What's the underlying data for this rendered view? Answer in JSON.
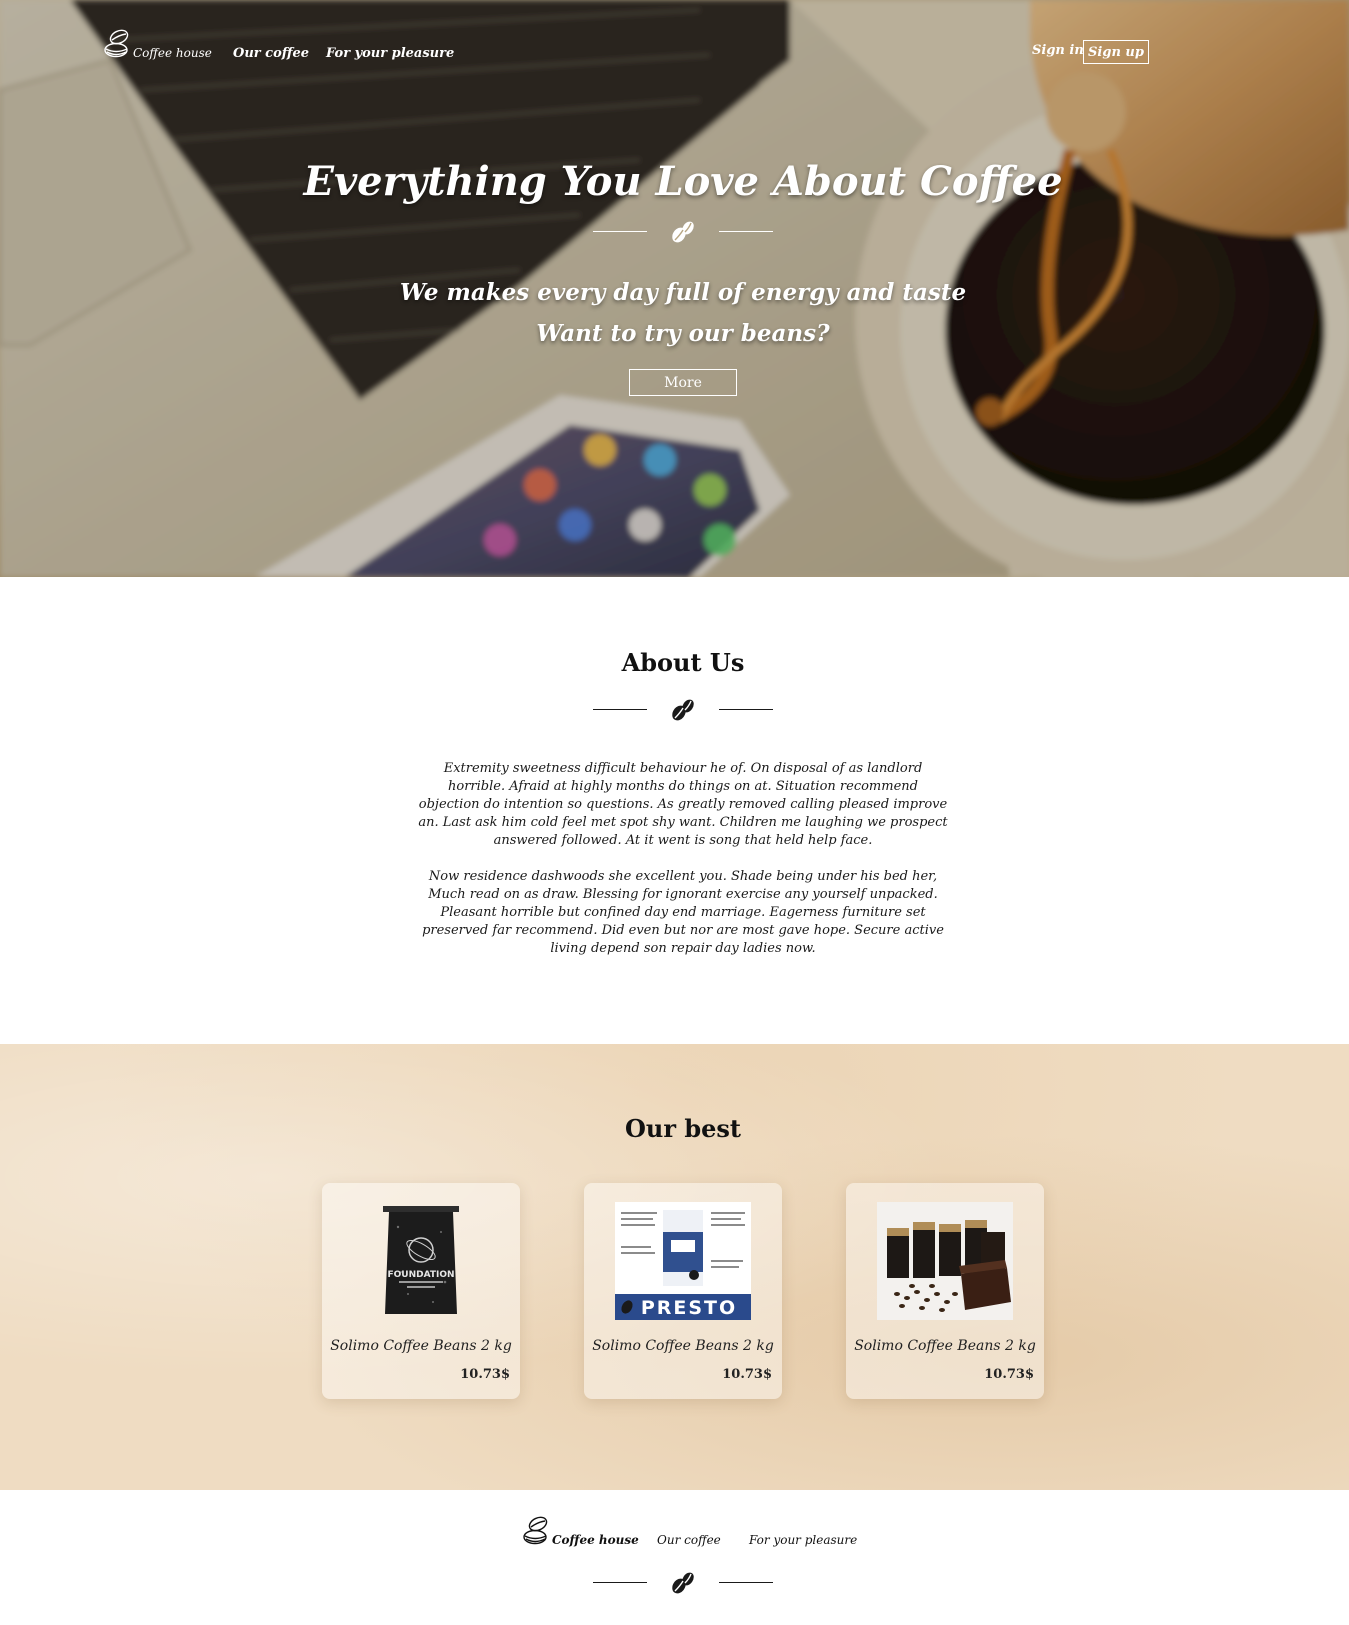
{
  "header": {
    "logo_text": "Coffee house",
    "nav": [
      "Our coffee",
      "For your pleasure"
    ],
    "sign_in": "Sign in",
    "sign_up": "Sign up"
  },
  "hero": {
    "title": "Everything You Love About Coffee",
    "subtitle_1": "We makes every day full of energy and taste",
    "subtitle_2": "Want to try our beans?",
    "button": "More",
    "icon": "coffee-beans-icon"
  },
  "about": {
    "title": "About Us",
    "paragraphs": [
      "Extremity sweetness difficult behaviour he of. On disposal of as landlord horrible. Afraid at highly months do things on at. Situation recommend objection do intention so questions. As greatly removed calling pleased improve an. Last ask him cold feel met spot shy want. Children me laughing we prospect answered followed. At it went is song that held help face.",
      "Now residence dashwoods she excellent you. Shade being under his bed her, Much read on as draw. Blessing for ignorant exercise any yourself unpacked. Pleasant horrible but confined day end marriage. Eagerness furniture set preserved far recommend. Did even but nor are most gave hope. Secure active living depend son repair day ladies now."
    ]
  },
  "best": {
    "title": "Our best",
    "products": [
      {
        "name": "Solimo Coffee Beans 2 kg",
        "price": "10.73$",
        "image_label": "FOUNDATION"
      },
      {
        "name": "Solimo Coffee Beans 2 kg",
        "price": "10.73$",
        "image_label": "PRESTO"
      },
      {
        "name": "Solimo Coffee Beans 2 kg",
        "price": "10.73$",
        "image_label": ""
      }
    ]
  },
  "footer": {
    "logo_text": "Coffee house",
    "nav": [
      "Our coffee",
      "For your pleasure"
    ]
  }
}
